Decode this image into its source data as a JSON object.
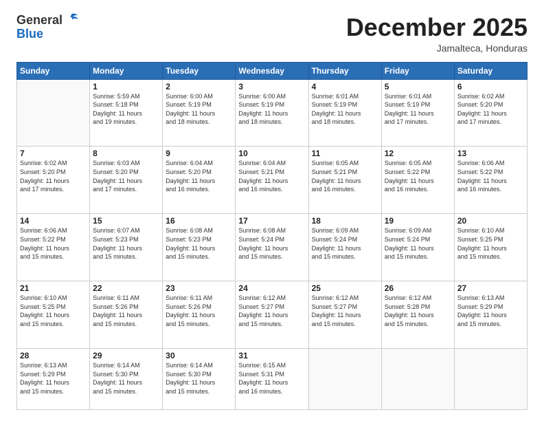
{
  "header": {
    "logo_general": "General",
    "logo_blue": "Blue",
    "month_title": "December 2025",
    "subtitle": "Jamalteca, Honduras"
  },
  "days_of_week": [
    "Sunday",
    "Monday",
    "Tuesday",
    "Wednesday",
    "Thursday",
    "Friday",
    "Saturday"
  ],
  "weeks": [
    [
      {
        "day": "",
        "info": ""
      },
      {
        "day": "1",
        "info": "Sunrise: 5:59 AM\nSunset: 5:18 PM\nDaylight: 11 hours\nand 19 minutes."
      },
      {
        "day": "2",
        "info": "Sunrise: 6:00 AM\nSunset: 5:19 PM\nDaylight: 11 hours\nand 18 minutes."
      },
      {
        "day": "3",
        "info": "Sunrise: 6:00 AM\nSunset: 5:19 PM\nDaylight: 11 hours\nand 18 minutes."
      },
      {
        "day": "4",
        "info": "Sunrise: 6:01 AM\nSunset: 5:19 PM\nDaylight: 11 hours\nand 18 minutes."
      },
      {
        "day": "5",
        "info": "Sunrise: 6:01 AM\nSunset: 5:19 PM\nDaylight: 11 hours\nand 17 minutes."
      },
      {
        "day": "6",
        "info": "Sunrise: 6:02 AM\nSunset: 5:20 PM\nDaylight: 11 hours\nand 17 minutes."
      }
    ],
    [
      {
        "day": "7",
        "info": "Sunrise: 6:02 AM\nSunset: 5:20 PM\nDaylight: 11 hours\nand 17 minutes."
      },
      {
        "day": "8",
        "info": "Sunrise: 6:03 AM\nSunset: 5:20 PM\nDaylight: 11 hours\nand 17 minutes."
      },
      {
        "day": "9",
        "info": "Sunrise: 6:04 AM\nSunset: 5:20 PM\nDaylight: 11 hours\nand 16 minutes."
      },
      {
        "day": "10",
        "info": "Sunrise: 6:04 AM\nSunset: 5:21 PM\nDaylight: 11 hours\nand 16 minutes."
      },
      {
        "day": "11",
        "info": "Sunrise: 6:05 AM\nSunset: 5:21 PM\nDaylight: 11 hours\nand 16 minutes."
      },
      {
        "day": "12",
        "info": "Sunrise: 6:05 AM\nSunset: 5:22 PM\nDaylight: 11 hours\nand 16 minutes."
      },
      {
        "day": "13",
        "info": "Sunrise: 6:06 AM\nSunset: 5:22 PM\nDaylight: 11 hours\nand 16 minutes."
      }
    ],
    [
      {
        "day": "14",
        "info": "Sunrise: 6:06 AM\nSunset: 5:22 PM\nDaylight: 11 hours\nand 15 minutes."
      },
      {
        "day": "15",
        "info": "Sunrise: 6:07 AM\nSunset: 5:23 PM\nDaylight: 11 hours\nand 15 minutes."
      },
      {
        "day": "16",
        "info": "Sunrise: 6:08 AM\nSunset: 5:23 PM\nDaylight: 11 hours\nand 15 minutes."
      },
      {
        "day": "17",
        "info": "Sunrise: 6:08 AM\nSunset: 5:24 PM\nDaylight: 11 hours\nand 15 minutes."
      },
      {
        "day": "18",
        "info": "Sunrise: 6:09 AM\nSunset: 5:24 PM\nDaylight: 11 hours\nand 15 minutes."
      },
      {
        "day": "19",
        "info": "Sunrise: 6:09 AM\nSunset: 5:24 PM\nDaylight: 11 hours\nand 15 minutes."
      },
      {
        "day": "20",
        "info": "Sunrise: 6:10 AM\nSunset: 5:25 PM\nDaylight: 11 hours\nand 15 minutes."
      }
    ],
    [
      {
        "day": "21",
        "info": "Sunrise: 6:10 AM\nSunset: 5:25 PM\nDaylight: 11 hours\nand 15 minutes."
      },
      {
        "day": "22",
        "info": "Sunrise: 6:11 AM\nSunset: 5:26 PM\nDaylight: 11 hours\nand 15 minutes."
      },
      {
        "day": "23",
        "info": "Sunrise: 6:11 AM\nSunset: 5:26 PM\nDaylight: 11 hours\nand 15 minutes."
      },
      {
        "day": "24",
        "info": "Sunrise: 6:12 AM\nSunset: 5:27 PM\nDaylight: 11 hours\nand 15 minutes."
      },
      {
        "day": "25",
        "info": "Sunrise: 6:12 AM\nSunset: 5:27 PM\nDaylight: 11 hours\nand 15 minutes."
      },
      {
        "day": "26",
        "info": "Sunrise: 6:12 AM\nSunset: 5:28 PM\nDaylight: 11 hours\nand 15 minutes."
      },
      {
        "day": "27",
        "info": "Sunrise: 6:13 AM\nSunset: 5:29 PM\nDaylight: 11 hours\nand 15 minutes."
      }
    ],
    [
      {
        "day": "28",
        "info": "Sunrise: 6:13 AM\nSunset: 5:29 PM\nDaylight: 11 hours\nand 15 minutes."
      },
      {
        "day": "29",
        "info": "Sunrise: 6:14 AM\nSunset: 5:30 PM\nDaylight: 11 hours\nand 15 minutes."
      },
      {
        "day": "30",
        "info": "Sunrise: 6:14 AM\nSunset: 5:30 PM\nDaylight: 11 hours\nand 15 minutes."
      },
      {
        "day": "31",
        "info": "Sunrise: 6:15 AM\nSunset: 5:31 PM\nDaylight: 11 hours\nand 16 minutes."
      },
      {
        "day": "",
        "info": ""
      },
      {
        "day": "",
        "info": ""
      },
      {
        "day": "",
        "info": ""
      }
    ]
  ]
}
